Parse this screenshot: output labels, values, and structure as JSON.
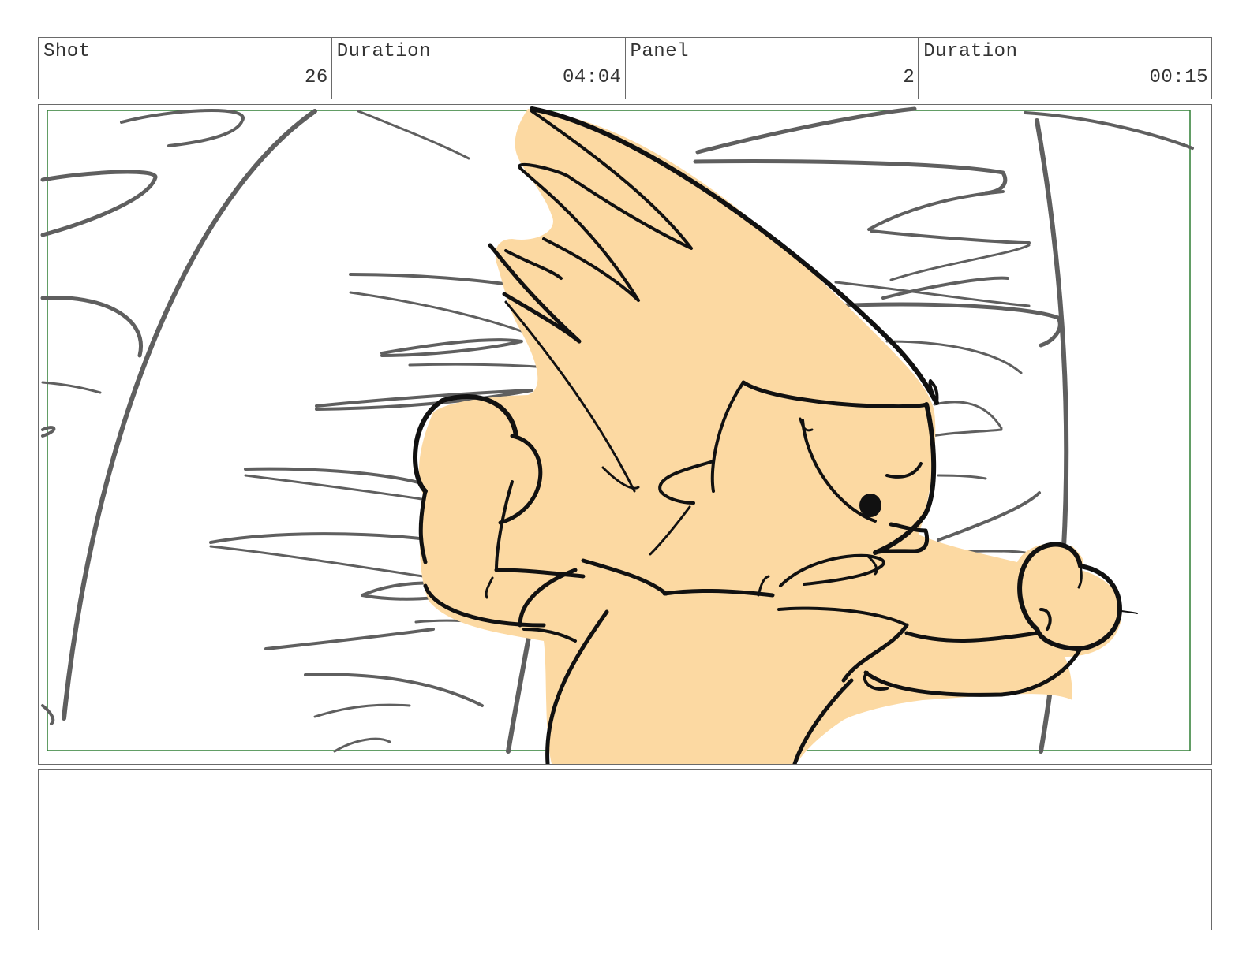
{
  "header": {
    "shot_label": "Shot",
    "shot_value": "26",
    "shot_duration_label": "Duration",
    "shot_duration_value": "04:04",
    "panel_label": "Panel",
    "panel_value": "2",
    "panel_duration_label": "Duration",
    "panel_duration_value": "00:15"
  },
  "colors": {
    "skin_fill": "#fcd9a2",
    "frame_line": "#2e7d32",
    "sketch_gray": "#5f5f5f",
    "ink": "#111111"
  },
  "notes": {
    "text": ""
  }
}
